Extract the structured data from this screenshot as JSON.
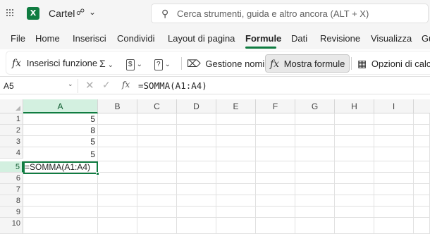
{
  "app": {
    "logo_letter": "X",
    "document_title": "Cartel",
    "brand_color": "#107c41"
  },
  "search": {
    "placeholder": "Cerca strumenti, guida e altro ancora (ALT + X)"
  },
  "menu": {
    "tabs": [
      "File",
      "Home",
      "Inserisci",
      "Condividi",
      "Layout di pagina",
      "Formule",
      "Dati",
      "Revisione",
      "Visualizza",
      "Gu"
    ],
    "active": "Formule"
  },
  "ribbon": {
    "insert_function": "Inserisci funzione",
    "name_manager": "Gestione nomi",
    "show_formulas": "Mostra formule",
    "calc_options": "Opzioni di calco"
  },
  "formula_bar": {
    "name_box": "A5",
    "formula": "=SOMMA(A1:A4)"
  },
  "sheet": {
    "columns": [
      "A",
      "B",
      "C",
      "D",
      "E",
      "F",
      "G",
      "H",
      "I"
    ],
    "rows": [
      "1",
      "2",
      "3",
      "4",
      "5",
      "6",
      "7",
      "8",
      "9",
      "10"
    ],
    "cells": {
      "A1": "5",
      "A2": "8",
      "A3": "5",
      "A4": "5",
      "A5": "=SOMMA(A1:A4)"
    },
    "active_cell": "A5"
  }
}
